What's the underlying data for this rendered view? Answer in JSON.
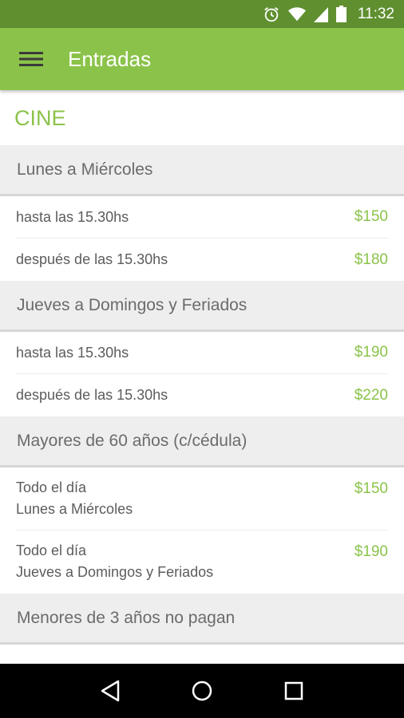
{
  "status_bar": {
    "time": "11:32",
    "icons": [
      "alarm-icon",
      "wifi-icon",
      "cell-signal-icon",
      "battery-icon"
    ]
  },
  "app_bar": {
    "title": "Entradas",
    "menu_icon": "hamburger-menu-icon"
  },
  "colors": {
    "accent": "#8bc34a",
    "status_bar": "#5f8f2f",
    "header_bg": "#eeeeee"
  },
  "main": {
    "section_title": "CINE",
    "groups": [
      {
        "header": "Lunes a Miércoles",
        "rows": [
          {
            "label": "hasta las 15.30hs",
            "price": "$150"
          },
          {
            "label": "después de las 15.30hs",
            "price": "$180"
          }
        ]
      },
      {
        "header": "Jueves a Domingos y Feriados",
        "rows": [
          {
            "label": "hasta las 15.30hs",
            "price": "$190"
          },
          {
            "label": "después de las 15.30hs",
            "price": "$220"
          }
        ]
      },
      {
        "header": "Mayores de 60 años (c/cédula)",
        "rows": [
          {
            "line1": "Todo el día",
            "line2": "Lunes a Miércoles",
            "price": "$150"
          },
          {
            "line1": "Todo el día",
            "line2": "Jueves a Domingos y Feriados",
            "price": "$190"
          }
        ]
      },
      {
        "header": "Menores de 3 años no pagan",
        "rows": []
      }
    ]
  },
  "nav_bar": {
    "buttons": [
      "back-icon",
      "home-icon",
      "recents-icon"
    ]
  }
}
